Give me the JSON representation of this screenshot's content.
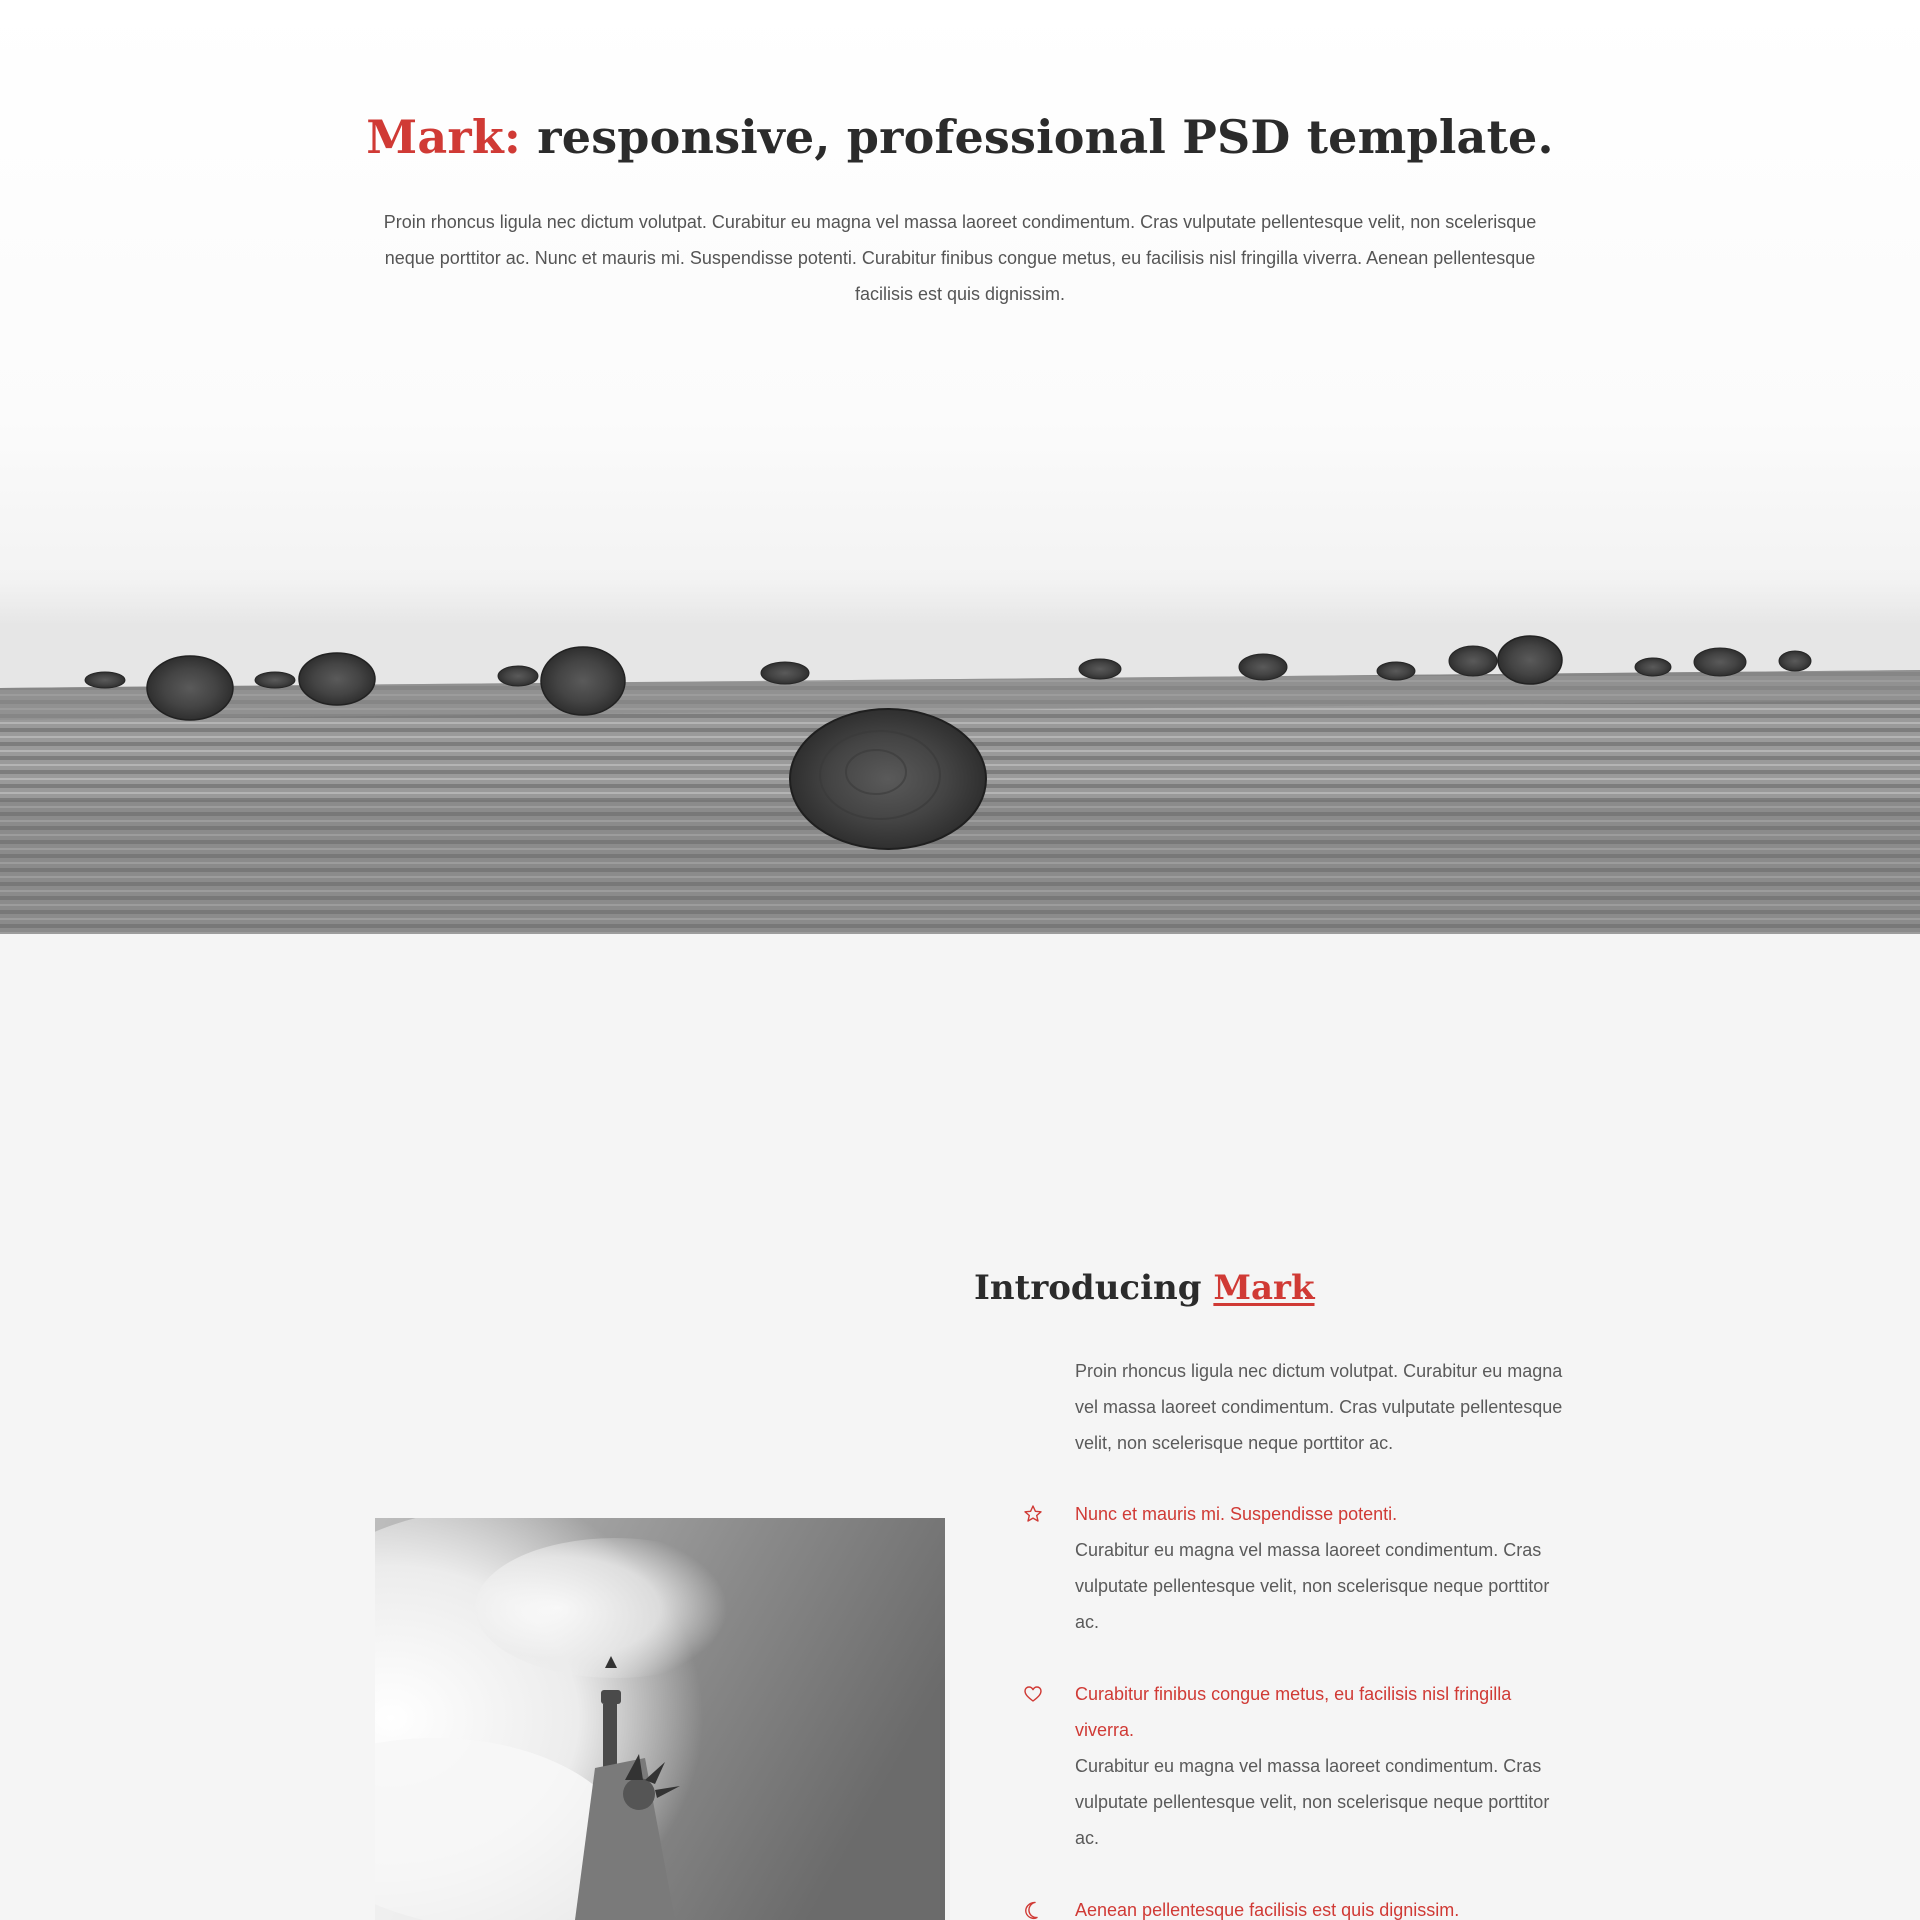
{
  "hero": {
    "title_accent": "Mark:",
    "title_rest": " responsive, professional PSD template.",
    "text": "Proin rhoncus ligula nec dictum volutpat. Curabitur eu magna vel massa laoreet condimentum. Cras vulputate pellentesque velit, non scelerisque neque porttitor ac. Nunc et mauris mi. Suspendisse potenti. Curabitur finibus congue metus, eu facilisis nisl fringilla viverra. Aenean pellentesque facilisis est quis dignissim."
  },
  "intro": {
    "title_prefix": "Introducing ",
    "title_link": "Mark",
    "text": "Proin rhoncus ligula nec dictum volutpat. Curabitur eu magna vel massa laoreet condimentum. Cras vulputate pellentesque velit, non scelerisque neque porttitor ac."
  },
  "features": [
    {
      "icon": "star-icon",
      "title": "Nunc et mauris mi. Suspendisse potenti.",
      "text": "Curabitur eu magna vel massa laoreet condimentum. Cras vulputate pellentesque velit, non scelerisque neque porttitor ac."
    },
    {
      "icon": "heart-icon",
      "title": "Curabitur finibus congue metus, eu facilisis nisl fringilla viverra.",
      "text": "Curabitur eu magna vel massa laoreet condimentum. Cras vulputate pellentesque velit, non scelerisque neque porttitor ac."
    },
    {
      "icon": "moon-icon",
      "title": "Aenean pellentesque facilisis est quis dignissim.",
      "text": ""
    }
  ],
  "colors": {
    "accent": "#d03a35",
    "heading": "#2b2b2b",
    "body_text": "#5a5a5a",
    "section_bg": "#f5f5f5"
  }
}
